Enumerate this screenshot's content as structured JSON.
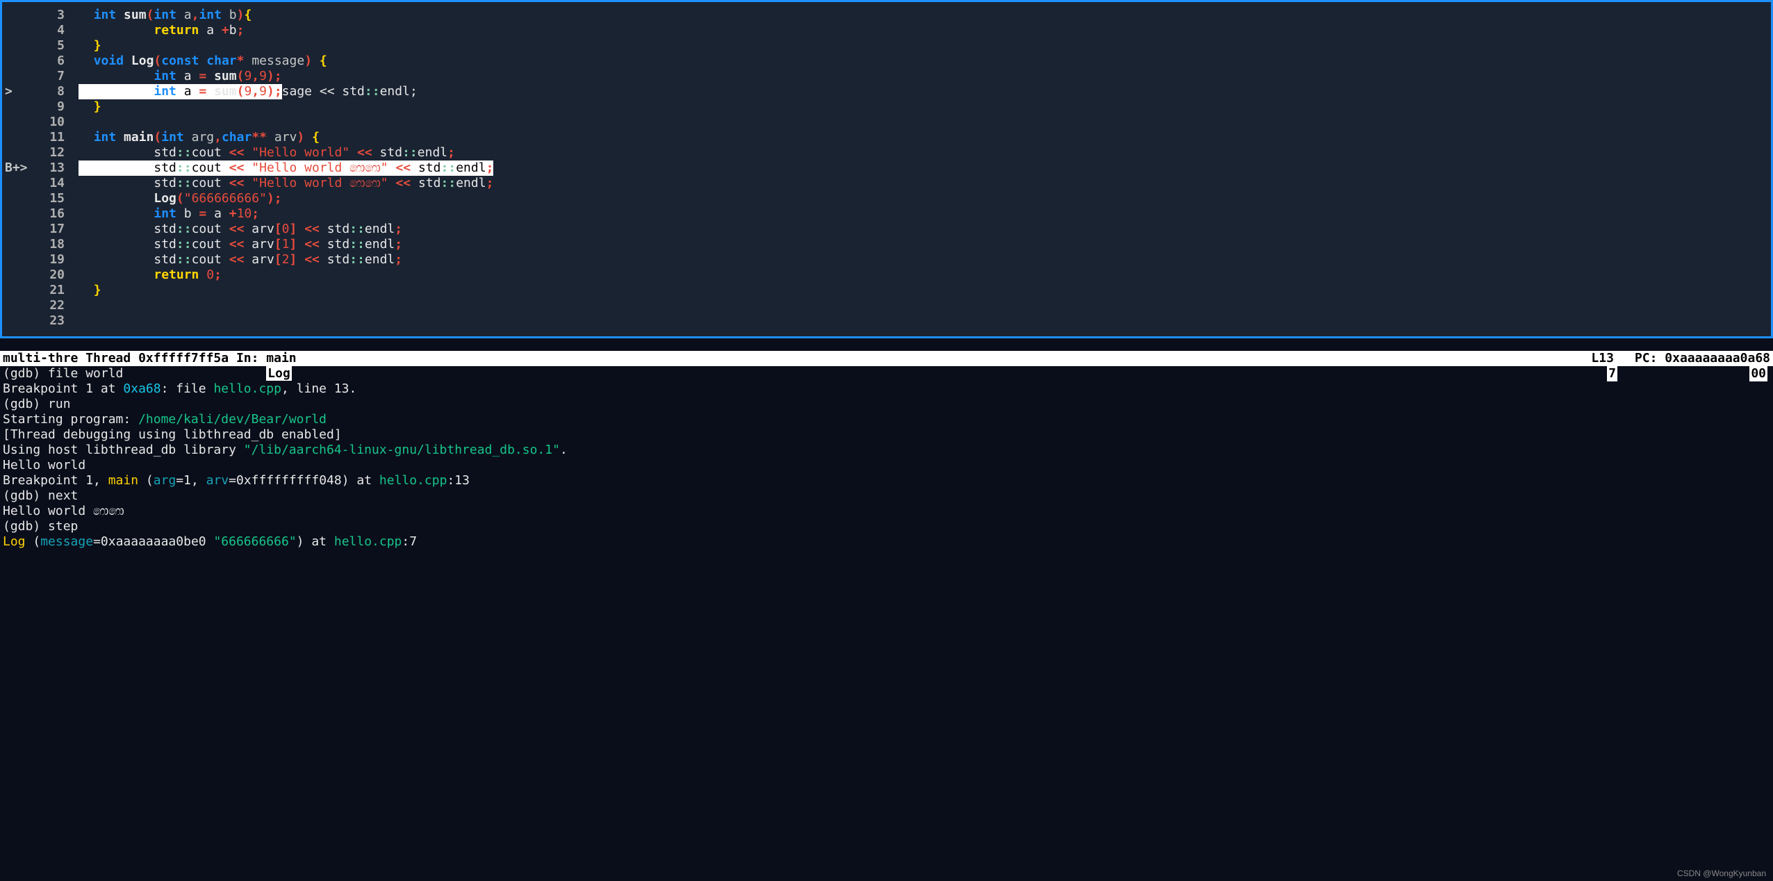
{
  "code": {
    "lines": [
      {
        "n": 3,
        "mark": "",
        "tokens": [
          {
            "t": "  ",
            "c": ""
          },
          {
            "t": "int",
            "c": "kw-type"
          },
          {
            "t": " ",
            "c": ""
          },
          {
            "t": "sum",
            "c": "kw-fn"
          },
          {
            "t": "(",
            "c": "punct-red"
          },
          {
            "t": "int",
            "c": "kw-type"
          },
          {
            "t": " a",
            "c": "param"
          },
          {
            "t": ",",
            "c": "punct-red"
          },
          {
            "t": "int",
            "c": "kw-type"
          },
          {
            "t": " b",
            "c": "param"
          },
          {
            "t": ")",
            "c": "punct-red"
          },
          {
            "t": "{",
            "c": "brace-yellow"
          }
        ]
      },
      {
        "n": 4,
        "mark": "",
        "tokens": [
          {
            "t": "          ",
            "c": ""
          },
          {
            "t": "return",
            "c": "kw-ctrl"
          },
          {
            "t": " a ",
            "c": "punct-white"
          },
          {
            "t": "+",
            "c": "punct-red"
          },
          {
            "t": "b",
            "c": "punct-white"
          },
          {
            "t": ";",
            "c": "punct-red"
          }
        ]
      },
      {
        "n": 5,
        "mark": "",
        "tokens": [
          {
            "t": "  ",
            "c": ""
          },
          {
            "t": "}",
            "c": "brace-yellow"
          }
        ]
      },
      {
        "n": 6,
        "mark": "",
        "tokens": [
          {
            "t": "  ",
            "c": ""
          },
          {
            "t": "void",
            "c": "kw-type"
          },
          {
            "t": " ",
            "c": ""
          },
          {
            "t": "Log",
            "c": "kw-fn"
          },
          {
            "t": "(",
            "c": "punct-red"
          },
          {
            "t": "const",
            "c": "kw-type"
          },
          {
            "t": " ",
            "c": ""
          },
          {
            "t": "char",
            "c": "kw-type"
          },
          {
            "t": "*",
            "c": "punct-red"
          },
          {
            "t": " message",
            "c": "param"
          },
          {
            "t": ")",
            "c": "punct-red"
          },
          {
            "t": " ",
            "c": ""
          },
          {
            "t": "{",
            "c": "brace-yellow"
          }
        ]
      },
      {
        "n": 7,
        "mark": "",
        "tokens": [
          {
            "t": "          ",
            "c": ""
          },
          {
            "t": "int",
            "c": "kw-type"
          },
          {
            "t": " a ",
            "c": "punct-white"
          },
          {
            "t": "=",
            "c": "punct-red"
          },
          {
            "t": " ",
            "c": ""
          },
          {
            "t": "sum",
            "c": "kw-fn"
          },
          {
            "t": "(",
            "c": "punct-red"
          },
          {
            "t": "9",
            "c": "num"
          },
          {
            "t": ",",
            "c": "punct-red"
          },
          {
            "t": "9",
            "c": "num"
          },
          {
            "t": ");",
            "c": "punct-red"
          }
        ]
      },
      {
        "n": 8,
        "mark": ">",
        "hl": true,
        "hl_tokens": [
          {
            "t": "          ",
            "c": ""
          },
          {
            "t": "int",
            "c": "kw-type"
          },
          {
            "t": " a ",
            "c": ""
          },
          {
            "t": "=",
            "c": "punct-red"
          },
          {
            "t": " ",
            "c": ""
          },
          {
            "t": "sum",
            "c": "kw-fn"
          },
          {
            "t": "(",
            "c": "punct-red"
          },
          {
            "t": "9",
            "c": "num"
          },
          {
            "t": ",",
            "c": "punct-red"
          },
          {
            "t": "9",
            "c": "num"
          },
          {
            "t": ");",
            "c": "punct-red"
          }
        ],
        "after_tokens": [
          {
            "t": "sage << std",
            "c": "punct-white"
          },
          {
            "t": "::",
            "c": "dbl-colon"
          },
          {
            "t": "endl",
            "c": "punct-white"
          },
          {
            "t": ";",
            "c": "punct-white"
          }
        ]
      },
      {
        "n": 9,
        "mark": "",
        "tokens": [
          {
            "t": "  ",
            "c": ""
          },
          {
            "t": "}",
            "c": "brace-yellow"
          }
        ]
      },
      {
        "n": 10,
        "mark": "",
        "tokens": []
      },
      {
        "n": 11,
        "mark": "",
        "tokens": [
          {
            "t": "  ",
            "c": ""
          },
          {
            "t": "int",
            "c": "kw-type"
          },
          {
            "t": " ",
            "c": ""
          },
          {
            "t": "main",
            "c": "kw-fn"
          },
          {
            "t": "(",
            "c": "punct-red"
          },
          {
            "t": "int",
            "c": "kw-type"
          },
          {
            "t": " arg",
            "c": "param"
          },
          {
            "t": ",",
            "c": "punct-red"
          },
          {
            "t": "char",
            "c": "kw-type"
          },
          {
            "t": "**",
            "c": "punct-red"
          },
          {
            "t": " arv",
            "c": "param"
          },
          {
            "t": ")",
            "c": "punct-red"
          },
          {
            "t": " ",
            "c": ""
          },
          {
            "t": "{",
            "c": "brace-yellow"
          }
        ]
      },
      {
        "n": 12,
        "mark": "",
        "tokens": [
          {
            "t": "          std",
            "c": "punct-white"
          },
          {
            "t": "::",
            "c": "dbl-colon"
          },
          {
            "t": "cout ",
            "c": "punct-white"
          },
          {
            "t": "<<",
            "c": "punct-red"
          },
          {
            "t": " ",
            "c": ""
          },
          {
            "t": "\"Hello world\"",
            "c": "str"
          },
          {
            "t": " ",
            "c": ""
          },
          {
            "t": "<<",
            "c": "punct-red"
          },
          {
            "t": " std",
            "c": "punct-white"
          },
          {
            "t": "::",
            "c": "dbl-colon"
          },
          {
            "t": "endl",
            "c": "punct-white"
          },
          {
            "t": ";",
            "c": "punct-red"
          }
        ]
      },
      {
        "n": 13,
        "mark": "B+>",
        "hl": true,
        "hl_tokens": [
          {
            "t": "          std",
            "c": ""
          },
          {
            "t": "::",
            "c": "dbl-colon"
          },
          {
            "t": "cout ",
            "c": ""
          },
          {
            "t": "<<",
            "c": "punct-red"
          },
          {
            "t": " ",
            "c": ""
          },
          {
            "t": "\"Hello world ෩෩\"",
            "c": "str"
          },
          {
            "t": " ",
            "c": ""
          },
          {
            "t": "<<",
            "c": "punct-red"
          },
          {
            "t": " std",
            "c": ""
          },
          {
            "t": "::",
            "c": "dbl-colon"
          },
          {
            "t": "endl",
            "c": ""
          },
          {
            "t": ";",
            "c": "punct-red"
          }
        ],
        "after_tokens": []
      },
      {
        "n": 14,
        "mark": "",
        "tokens": [
          {
            "t": "          std",
            "c": "punct-white"
          },
          {
            "t": "::",
            "c": "dbl-colon"
          },
          {
            "t": "cout ",
            "c": "punct-white"
          },
          {
            "t": "<<",
            "c": "punct-red"
          },
          {
            "t": " ",
            "c": ""
          },
          {
            "t": "\"Hello world ෩෩\"",
            "c": "str"
          },
          {
            "t": " ",
            "c": ""
          },
          {
            "t": "<<",
            "c": "punct-red"
          },
          {
            "t": " std",
            "c": "punct-white"
          },
          {
            "t": "::",
            "c": "dbl-colon"
          },
          {
            "t": "endl",
            "c": "punct-white"
          },
          {
            "t": ";",
            "c": "punct-red"
          }
        ]
      },
      {
        "n": 15,
        "mark": "",
        "tokens": [
          {
            "t": "          ",
            "c": ""
          },
          {
            "t": "Log",
            "c": "kw-fn"
          },
          {
            "t": "(",
            "c": "punct-red"
          },
          {
            "t": "\"666666666\"",
            "c": "str"
          },
          {
            "t": ");",
            "c": "punct-red"
          }
        ]
      },
      {
        "n": 16,
        "mark": "",
        "tokens": [
          {
            "t": "          ",
            "c": ""
          },
          {
            "t": "int",
            "c": "kw-type"
          },
          {
            "t": " b ",
            "c": "punct-white"
          },
          {
            "t": "=",
            "c": "punct-red"
          },
          {
            "t": " a ",
            "c": "punct-white"
          },
          {
            "t": "+",
            "c": "punct-red"
          },
          {
            "t": "10",
            "c": "num"
          },
          {
            "t": ";",
            "c": "punct-red"
          }
        ]
      },
      {
        "n": 17,
        "mark": "",
        "tokens": [
          {
            "t": "          std",
            "c": "punct-white"
          },
          {
            "t": "::",
            "c": "dbl-colon"
          },
          {
            "t": "cout ",
            "c": "punct-white"
          },
          {
            "t": "<<",
            "c": "punct-red"
          },
          {
            "t": " arv",
            "c": "punct-white"
          },
          {
            "t": "[",
            "c": "bracket-red"
          },
          {
            "t": "0",
            "c": "num"
          },
          {
            "t": "]",
            "c": "bracket-red"
          },
          {
            "t": " ",
            "c": ""
          },
          {
            "t": "<<",
            "c": "punct-red"
          },
          {
            "t": " std",
            "c": "punct-white"
          },
          {
            "t": "::",
            "c": "dbl-colon"
          },
          {
            "t": "endl",
            "c": "punct-white"
          },
          {
            "t": ";",
            "c": "punct-red"
          }
        ]
      },
      {
        "n": 18,
        "mark": "",
        "tokens": [
          {
            "t": "          std",
            "c": "punct-white"
          },
          {
            "t": "::",
            "c": "dbl-colon"
          },
          {
            "t": "cout ",
            "c": "punct-white"
          },
          {
            "t": "<<",
            "c": "punct-red"
          },
          {
            "t": " arv",
            "c": "punct-white"
          },
          {
            "t": "[",
            "c": "bracket-red"
          },
          {
            "t": "1",
            "c": "num"
          },
          {
            "t": "]",
            "c": "bracket-red"
          },
          {
            "t": " ",
            "c": ""
          },
          {
            "t": "<<",
            "c": "punct-red"
          },
          {
            "t": " std",
            "c": "punct-white"
          },
          {
            "t": "::",
            "c": "dbl-colon"
          },
          {
            "t": "endl",
            "c": "punct-white"
          },
          {
            "t": ";",
            "c": "punct-red"
          }
        ]
      },
      {
        "n": 19,
        "mark": "",
        "tokens": [
          {
            "t": "          std",
            "c": "punct-white"
          },
          {
            "t": "::",
            "c": "dbl-colon"
          },
          {
            "t": "cout ",
            "c": "punct-white"
          },
          {
            "t": "<<",
            "c": "punct-red"
          },
          {
            "t": " arv",
            "c": "punct-white"
          },
          {
            "t": "[",
            "c": "bracket-red"
          },
          {
            "t": "2",
            "c": "num"
          },
          {
            "t": "]",
            "c": "bracket-red"
          },
          {
            "t": " ",
            "c": ""
          },
          {
            "t": "<<",
            "c": "punct-red"
          },
          {
            "t": " std",
            "c": "punct-white"
          },
          {
            "t": "::",
            "c": "dbl-colon"
          },
          {
            "t": "endl",
            "c": "punct-white"
          },
          {
            "t": ";",
            "c": "punct-red"
          }
        ]
      },
      {
        "n": 20,
        "mark": "",
        "tokens": [
          {
            "t": "          ",
            "c": ""
          },
          {
            "t": "return",
            "c": "kw-ctrl"
          },
          {
            "t": " ",
            "c": ""
          },
          {
            "t": "0",
            "c": "num"
          },
          {
            "t": ";",
            "c": "punct-red"
          }
        ]
      },
      {
        "n": 21,
        "mark": "",
        "tokens": [
          {
            "t": "  ",
            "c": ""
          },
          {
            "t": "}",
            "c": "brace-yellow"
          }
        ]
      },
      {
        "n": 22,
        "mark": "",
        "tokens": []
      },
      {
        "n": 23,
        "mark": "",
        "tokens": []
      }
    ]
  },
  "status": {
    "left": "multi-thre Thread 0xfffff7ff5a In: main",
    "line": "L13",
    "pc": "PC: 0xaaaaaaaa0a68"
  },
  "gdb": {
    "lines": [
      {
        "segs": [
          {
            "t": "(gdb) file world",
            "c": "gdb-white"
          },
          {
            "t": "                   ",
            "c": ""
          },
          {
            "t": "Log",
            "c": "gdb-hlbox"
          }
        ],
        "tail7": true
      },
      {
        "segs": [
          {
            "t": "Breakpoint 1 at ",
            "c": "gdb-white"
          },
          {
            "t": "0xa68",
            "c": "gdb-cyan"
          },
          {
            "t": ": file ",
            "c": "gdb-white"
          },
          {
            "t": "hello.cpp",
            "c": "gdb-green"
          },
          {
            "t": ", line 13.",
            "c": "gdb-white"
          }
        ]
      },
      {
        "segs": [
          {
            "t": "(gdb) run",
            "c": "gdb-white"
          }
        ]
      },
      {
        "segs": [
          {
            "t": "Starting program: ",
            "c": "gdb-white"
          },
          {
            "t": "/home/kali/dev/Bear/world",
            "c": "gdb-green"
          }
        ]
      },
      {
        "segs": [
          {
            "t": "[Thread debugging using libthread_db enabled]",
            "c": "gdb-white"
          }
        ]
      },
      {
        "segs": [
          {
            "t": "Using host libthread_db library ",
            "c": "gdb-white"
          },
          {
            "t": "\"/lib/aarch64-linux-gnu/libthread_db.so.1\"",
            "c": "gdb-green"
          },
          {
            "t": ".",
            "c": "gdb-white"
          }
        ]
      },
      {
        "segs": [
          {
            "t": "Hello world",
            "c": "gdb-white"
          }
        ]
      },
      {
        "segs": [
          {
            "t": "Breakpoint 1, ",
            "c": "gdb-white"
          },
          {
            "t": "main",
            "c": "gdb-yellow"
          },
          {
            "t": " (",
            "c": "gdb-white"
          },
          {
            "t": "arg",
            "c": "gdb-teal"
          },
          {
            "t": "=1, ",
            "c": "gdb-white"
          },
          {
            "t": "arv",
            "c": "gdb-teal"
          },
          {
            "t": "=0xfffffffff048) at ",
            "c": "gdb-white"
          },
          {
            "t": "hello.cpp",
            "c": "gdb-green"
          },
          {
            "t": ":13",
            "c": "gdb-white"
          }
        ]
      },
      {
        "segs": [
          {
            "t": "(gdb) next",
            "c": "gdb-white"
          }
        ]
      },
      {
        "segs": [
          {
            "t": "Hello world ෩෩",
            "c": "gdb-white"
          }
        ]
      },
      {
        "segs": [
          {
            "t": "(gdb) step",
            "c": "gdb-white"
          }
        ]
      },
      {
        "segs": [
          {
            "t": "Log",
            "c": "gdb-yellow"
          },
          {
            "t": " (",
            "c": "gdb-white"
          },
          {
            "t": "message",
            "c": "gdb-teal"
          },
          {
            "t": "=0xaaaaaaaa0be0 ",
            "c": "gdb-white"
          },
          {
            "t": "\"666666666\"",
            "c": "gdb-green"
          },
          {
            "t": ") at ",
            "c": "gdb-white"
          },
          {
            "t": "hello.cpp",
            "c": "gdb-green"
          },
          {
            "t": ":7",
            "c": "gdb-white"
          }
        ]
      }
    ],
    "tail7": "7",
    "tail00": "00"
  },
  "watermark": "CSDN @WongKyunban"
}
